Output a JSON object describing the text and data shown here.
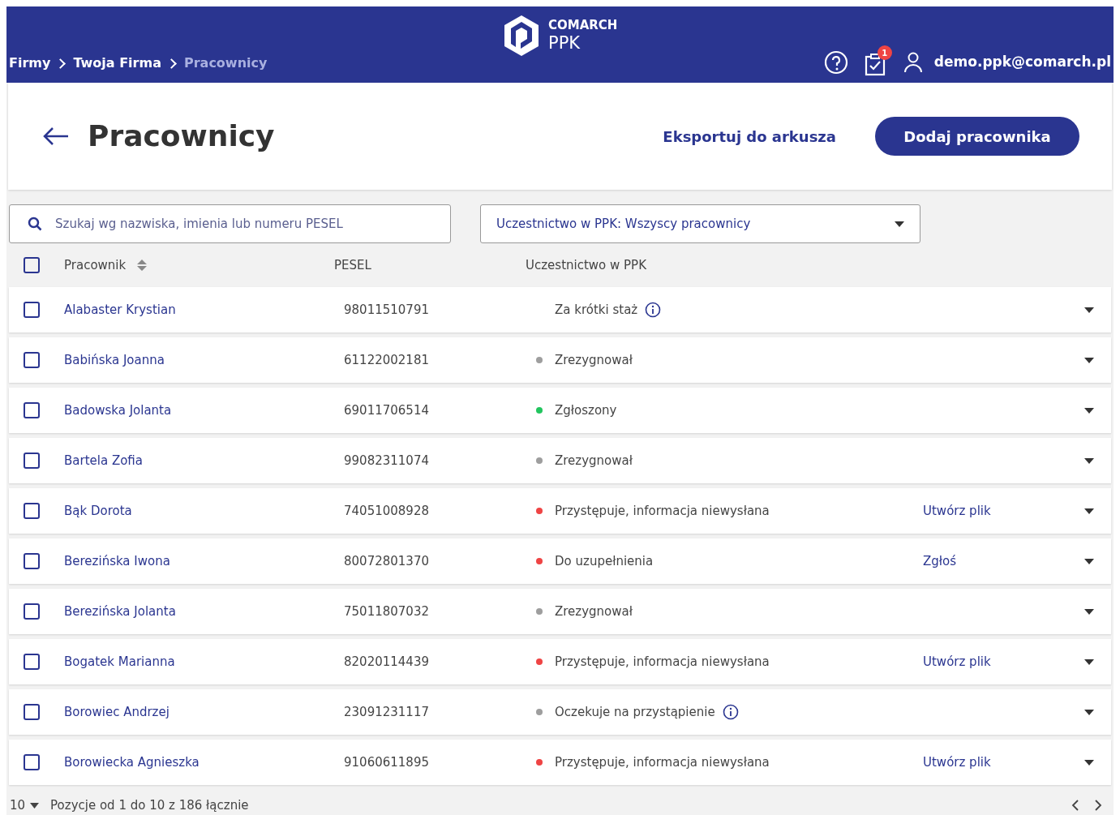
{
  "header": {
    "breadcrumbs": [
      {
        "label": "Firmy",
        "current": false
      },
      {
        "label": "Twoja Firma",
        "current": false
      },
      {
        "label": "Pracownicy",
        "current": true
      }
    ],
    "logo": {
      "brand": "COMARCH",
      "product": "PPK"
    },
    "notifications": "1",
    "user": "demo.ppk@comarch.pl"
  },
  "page": {
    "title": "Pracownicy",
    "export": "Eksportuj do arkusza",
    "add": "Dodaj pracownika"
  },
  "search": {
    "placeholder": "Szukaj wg nazwiska, imienia lub numeru PESEL"
  },
  "filter": {
    "value": "Uczestnictwo w PPK: Wszyscy pracownicy"
  },
  "table": {
    "columns": [
      "Pracownik",
      "PESEL",
      "Uczestnictwo w PPK"
    ],
    "select_all": false,
    "rows": [
      {
        "name": "Alabaster Krystian",
        "pesel": "98011510791",
        "status": "Za krótki staż",
        "info": true,
        "checked": false
      },
      {
        "name": "Babińska Joanna",
        "pesel": "61122002181",
        "status": "Zrezygnował",
        "color": "#9e9e9e",
        "info": false,
        "checked": false
      },
      {
        "name": "Badowska Jolanta",
        "pesel": "69011706514",
        "status": "Zgłoszony",
        "color": "#22c55e",
        "info": false,
        "checked": false
      },
      {
        "name": "Bartela Zofia",
        "pesel": "99082311074",
        "status": "Zrezygnował",
        "color": "#9e9e9e",
        "info": false,
        "checked": false
      },
      {
        "name": "Bąk Dorota",
        "pesel": "74051008928",
        "status": "Przystępuje, informacja niewysłana",
        "color": "#ef4444",
        "info": false,
        "action": "Utwórz plik",
        "checked": false
      },
      {
        "name": "Berezińska Iwona",
        "pesel": "80072801370",
        "status": "Do uzupełnienia",
        "color": "#ef4444",
        "info": false,
        "action": "Zgłoś",
        "checked": false
      },
      {
        "name": "Berezińska Jolanta",
        "pesel": "75011807032",
        "status": "Zrezygnował",
        "color": "#9e9e9e",
        "info": false,
        "checked": false
      },
      {
        "name": "Bogatek Marianna",
        "pesel": "82020114439",
        "status": "Przystępuje, informacja niewysłana",
        "color": "#ef4444",
        "info": false,
        "action": "Utwórz plik",
        "checked": false
      },
      {
        "name": "Borowiec Andrzej",
        "pesel": "23091231117",
        "status": "Oczekuje na przystąpienie",
        "color": "#9e9e9e",
        "info": true,
        "checked": false
      },
      {
        "name": "Borowiecka Agnieszka",
        "pesel": "91060611895",
        "status": "Przystępuje, informacja niewysłana",
        "color": "#ef4444",
        "info": false,
        "action": "Utwórz plik",
        "checked": false
      }
    ]
  },
  "footer": {
    "page_size": "10",
    "summary": "Pozycje od 1 do 10 z 186 łącznie"
  }
}
